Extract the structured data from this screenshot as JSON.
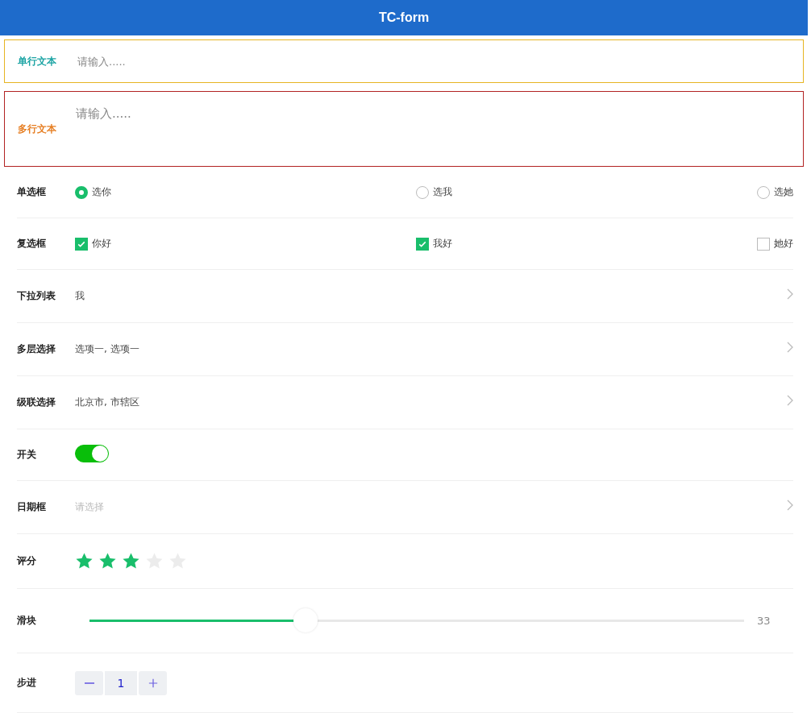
{
  "header": {
    "title": "TC-form"
  },
  "fields": [
    {
      "kind": "text",
      "label": "单行文本",
      "color": "#1aa3a3",
      "placeholder": "请输入....."
    },
    {
      "kind": "textarea",
      "label": "多行文本",
      "color": "#e67e22",
      "placeholder": "请输入....."
    },
    {
      "kind": "radio",
      "label": "单选框",
      "options": [
        {
          "label": "选你",
          "selected": true
        },
        {
          "label": "选我",
          "selected": false
        },
        {
          "label": "选她",
          "selected": false
        }
      ]
    },
    {
      "kind": "checkbox",
      "label": "复选框",
      "options": [
        {
          "label": "你好",
          "checked": true
        },
        {
          "label": "我好",
          "checked": true
        },
        {
          "label": "她好",
          "checked": false
        }
      ]
    },
    {
      "kind": "picker",
      "label": "下拉列表",
      "value": "我"
    },
    {
      "kind": "picker",
      "label": "多层选择",
      "value": "选项一, 选项一"
    },
    {
      "kind": "picker",
      "label": "级联选择",
      "value": "北京市, 市辖区"
    },
    {
      "kind": "switch",
      "label": "开关",
      "on": true
    },
    {
      "kind": "picker",
      "label": "日期框",
      "placeholder": "请选择"
    },
    {
      "kind": "rate",
      "label": "评分",
      "stars": 3
    },
    {
      "kind": "slider",
      "label": "滑块",
      "level": 0.33,
      "reading": "33"
    },
    {
      "kind": "stepper",
      "label": "步进",
      "value": "1"
    }
  ]
}
